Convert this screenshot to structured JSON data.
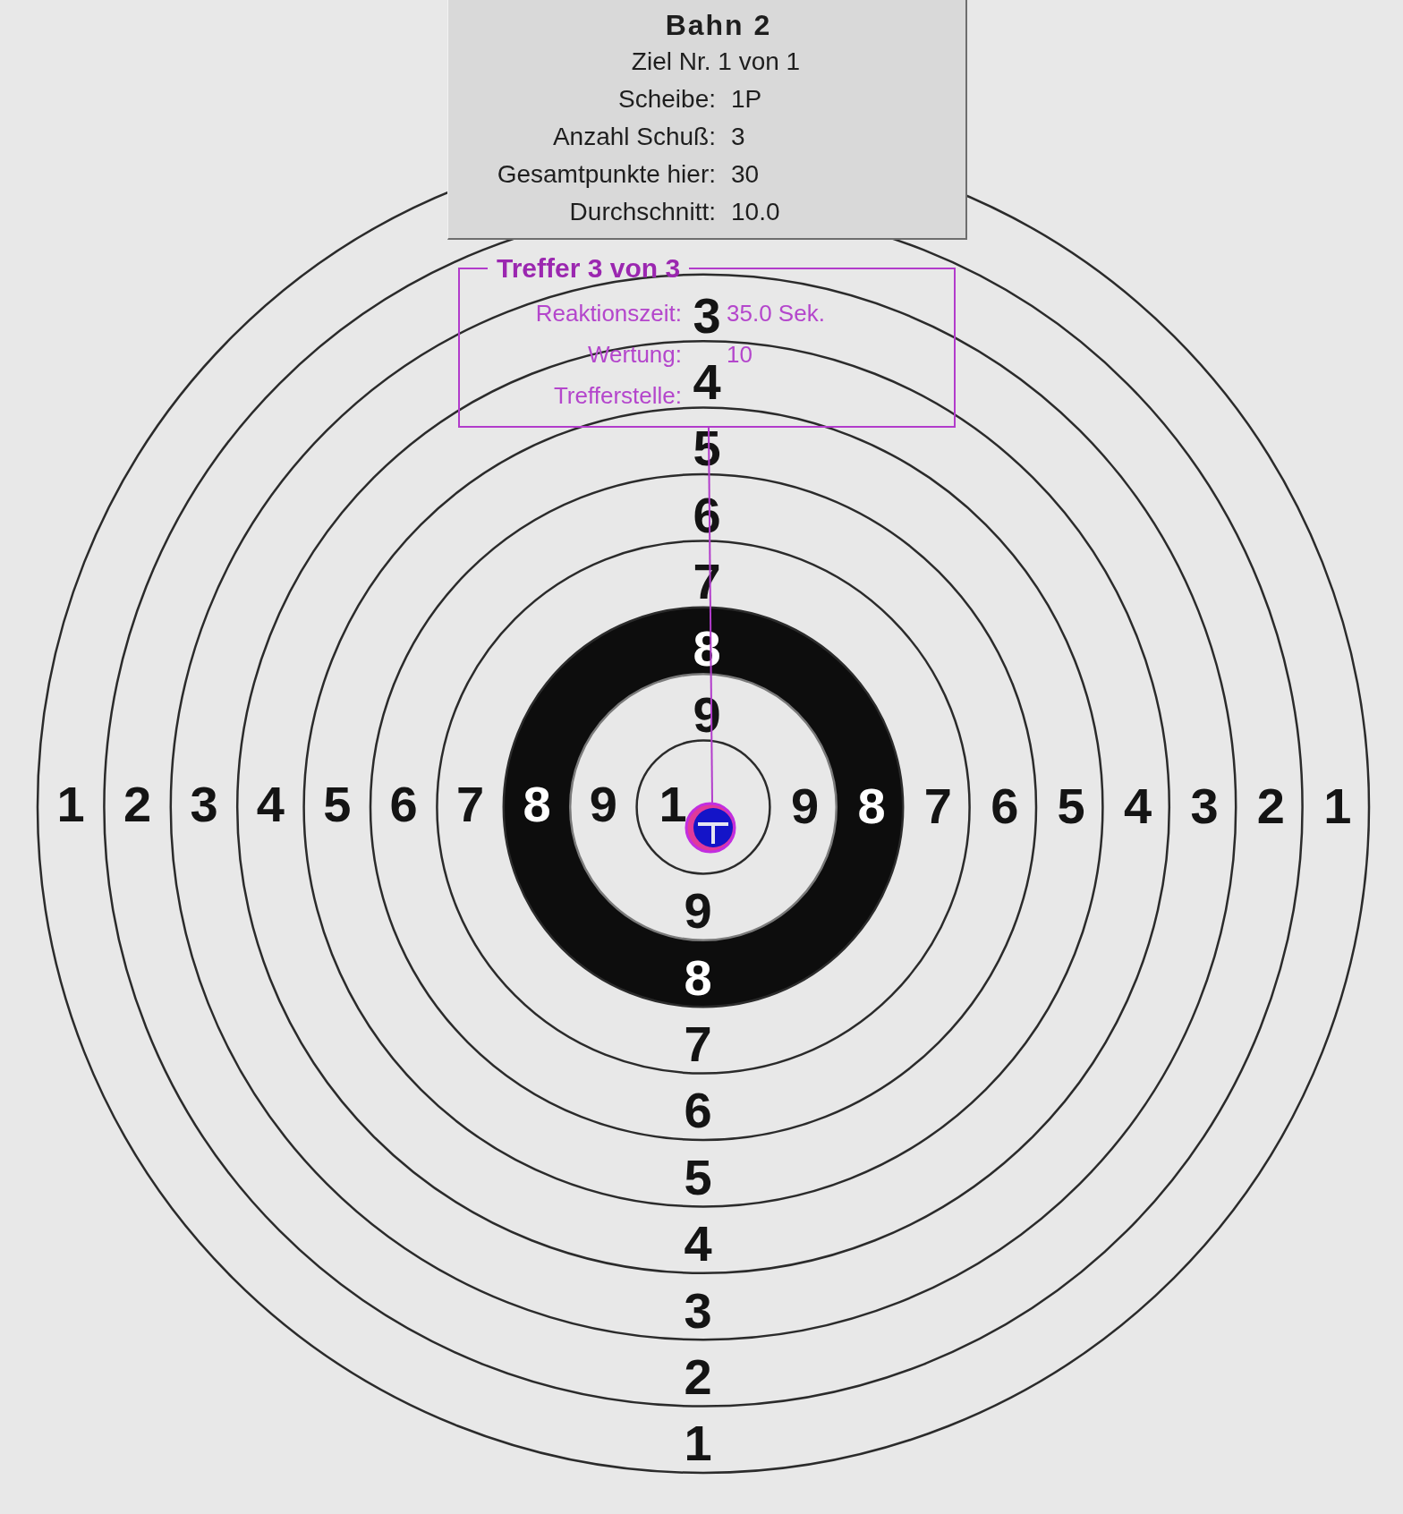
{
  "info_panel": {
    "title": "Bahn 2",
    "subtitle": "Ziel Nr. 1 von 1",
    "rows": [
      {
        "label": "Scheibe:",
        "value": "1P"
      },
      {
        "label": "Anzahl Schuß:",
        "value": "3"
      },
      {
        "label": "Gesamtpunkte hier:",
        "value": "30"
      },
      {
        "label": "Durchschnitt:",
        "value": "10.0"
      }
    ]
  },
  "hit_panel": {
    "title": "Treffer 3 von 3",
    "rows": [
      {
        "label": "Reaktionszeit:",
        "value": "35.0 Sek."
      },
      {
        "label": "Wertung:",
        "value": "10"
      },
      {
        "label": "Trefferstelle:"
      }
    ]
  },
  "target": {
    "left_labels": [
      "1",
      "2",
      "3",
      "4",
      "5",
      "6",
      "7",
      "8",
      "9"
    ],
    "center_label": "1",
    "right_labels": [
      "9",
      "8",
      "7",
      "6",
      "5",
      "4",
      "3",
      "2",
      "1"
    ],
    "top_labels": [
      "3",
      "4",
      "5",
      "6",
      "7",
      "8",
      "9"
    ],
    "bottom_labels": [
      "9",
      "8",
      "7",
      "6",
      "5",
      "4",
      "3",
      "2",
      "1"
    ]
  }
}
